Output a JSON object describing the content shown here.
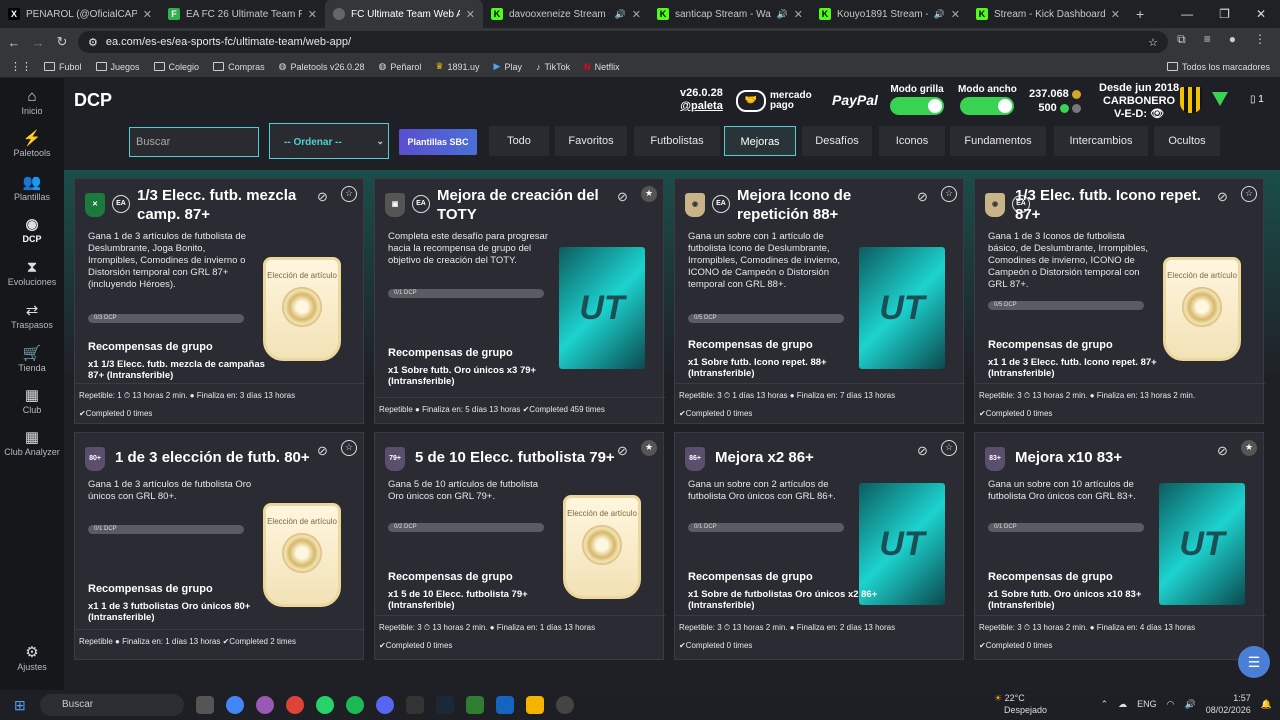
{
  "browser": {
    "tabs": [
      {
        "label": "PEÑAROL (@OficialCAP) / X",
        "favicon": "X",
        "color": "#000000"
      },
      {
        "label": "EA FC 26 Ultimate Team Prices,",
        "favicon": "F",
        "color": "#2db34a"
      },
      {
        "label": "FC Ultimate Team Web App - E",
        "favicon": "•",
        "color": "#555555"
      },
      {
        "label": "davooxeneize Stream - Wat",
        "favicon": "K",
        "color": "#53fc18"
      },
      {
        "label": "santicap Stream - Watch Li",
        "favicon": "K",
        "color": "#53fc18"
      },
      {
        "label": "Kouyo1891 Stream - Watch",
        "favicon": "K",
        "color": "#53fc18"
      },
      {
        "label": "Stream - Kick Dashboard",
        "favicon": "K",
        "color": "#53fc18"
      }
    ],
    "new_tab": "+",
    "url": "ea.com/es-es/ea-sports-fc/ultimate-team/web-app/",
    "bookmarks": [
      "Fubol",
      "Juegos",
      "Colegio",
      "Compras",
      "Paletools v26.0.28",
      "Peñarol",
      "1891.uy",
      "Play",
      "TikTok",
      "Netflix"
    ],
    "all_bookmarks": "Todos los marcadores"
  },
  "sidebar": [
    {
      "label": "Inicio",
      "icon": "home-icon",
      "glyph": "⌂"
    },
    {
      "label": "Paletools",
      "icon": "paletools-icon",
      "glyph": "⚡"
    },
    {
      "label": "Plantillas",
      "icon": "squad-icon",
      "glyph": "👥"
    },
    {
      "label": "DCP",
      "icon": "dcp-icon",
      "glyph": "◉"
    },
    {
      "label": "Evoluciones",
      "icon": "evolutions-icon",
      "glyph": "⧗"
    },
    {
      "label": "Traspasos",
      "icon": "transfers-icon",
      "glyph": "⇄"
    },
    {
      "label": "Tienda",
      "icon": "store-icon",
      "glyph": "🛒"
    },
    {
      "label": "Club",
      "icon": "club-icon",
      "glyph": "▦"
    },
    {
      "label": "Club Analyzer",
      "icon": "club-analyzer-icon",
      "glyph": "▦"
    },
    {
      "label": "Ajustes",
      "icon": "settings-icon",
      "glyph": "⚙"
    }
  ],
  "header": {
    "title": "DCP",
    "version": "v26.0.28",
    "user": "@paleta",
    "mercado_pago": [
      "mercado",
      "pago"
    ],
    "paypal": "PayPal",
    "toggle_grid": "Modo grilla",
    "toggle_wide": "Modo ancho",
    "coins": "237.068",
    "points": "500",
    "club_since": "Desde jun 2018",
    "club_name": "CARBONERO",
    "club_record": "V-E-D:",
    "count": "1"
  },
  "filters": {
    "search_placeholder": "Buscar",
    "sort": "-- Ordenar --",
    "sbc_button": "Plantillas SBC",
    "tabs": [
      "Todo",
      "Favoritos",
      "Futbolistas",
      "Mejoras",
      "Desafíos",
      "Iconos",
      "Fundamentos",
      "Intercambios",
      "Ocultos"
    ],
    "active_tab": "Mejoras"
  },
  "cards": [
    {
      "title": "1/3 Elecc. futb. mezcla camp. 87+",
      "desc": "Gana 1 de 3 artículos de futbolista de Deslumbrante, Joga Bonito, Irrompibles, Comodines de invierno o Distorsión temporal con GRL 87+ (incluyendo Héroes).",
      "progress": "0/3 DCP",
      "rewards_label": "Recompensas de grupo",
      "reward": "x1 1/3 Elecc. futb. mezcla de campañas 87+ (Intransferible)",
      "footer1": "Repetible: 1 ⏱ 13 horas 2 min. ● Finaliza en: 3 días 13 horas",
      "footer2": "✔Completed 0 times",
      "image_label": "Elección de artículo"
    },
    {
      "title": "Mejora de creación del TOTY",
      "desc": "Completa este desafío para progresar hacia la recompensa de grupo del objetivo de creación del TOTY.",
      "progress": "0/1 DCP",
      "rewards_label": "Recompensas de grupo",
      "reward": "x1 Sobre futb. Oro únicos x3 79+ (Intransferible)",
      "footer1": "Repetible ● Finaliza en: 5 días 13 horas ✔Completed 459 times",
      "footer2": ""
    },
    {
      "title": "Mejora Icono de repetición 88+",
      "desc": "Gana un sobre con 1 artículo de futbolista Icono de Deslumbrante, Irrompibles, Comodines de invierno, ICONO de Campeón o Distorsión temporal con GRL 88+.",
      "progress": "0/5 DCP",
      "rewards_label": "Recompensas de grupo",
      "reward": "x1 Sobre futb. Icono repet. 88+ (Intransferible)",
      "footer1": "Repetible: 3 ⏱ 1 días 13 horas ● Finaliza en: 7 días 13 horas",
      "footer2": "✔Completed 0 times"
    },
    {
      "title": "1/3 Elec. futb. Icono repet. 87+",
      "desc": "Gana 1 de 3 Iconos de futbolista básico, de Deslumbrante, Irrompibles, Comodines de invierno, ICONO de Campeón o Distorsión temporal con GRL 87+.",
      "progress": "0/5 DCP",
      "rewards_label": "Recompensas de grupo",
      "reward": "x1 1 de 3 Elecc. futb. Icono repet. 87+ (Intransferible)",
      "footer1": "Repetible: 3 ⏱ 13 horas 2 min. ● Finaliza en: 13 horas 2 min.",
      "footer2": "✔Completed 0 times",
      "image_label": "Elección de artículo"
    },
    {
      "title": "1 de 3 elección de futb. 80+",
      "desc": "Gana 1 de 3 artículos de futbolista Oro únicos con GRL 80+.",
      "progress": "0/1 DCP",
      "rewards_label": "Recompensas de grupo",
      "reward": "x1 1 de 3 futbolistas Oro únicos 80+ (Intransferible)",
      "footer1": "Repetible ● Finaliza en: 1 días 13 horas ✔Completed 2 times",
      "footer2": "",
      "image_label": "Elección de artículo",
      "badge": "80+"
    },
    {
      "title": "5 de 10 Elecc. futbolista 79+",
      "desc": "Gana 5 de 10 artículos de futbolista Oro únicos con GRL 79+.",
      "progress": "0/2 DCP",
      "rewards_label": "Recompensas de grupo",
      "reward": "x1 5 de 10 Elecc. futbolista 79+ (Intransferible)",
      "footer1": "Repetible: 3 ⏱ 13 horas 2 min. ● Finaliza en: 1 días 13 horas",
      "footer2": "✔Completed 0 times",
      "image_label": "Elección de artículo",
      "badge": "79+"
    },
    {
      "title": "Mejora x2 86+",
      "desc": "Gana un sobre con 2 artículos de futbolista Oro únicos con GRL 86+.",
      "progress": "0/1 DCP",
      "rewards_label": "Recompensas de grupo",
      "reward": "x1 Sobre de futbolistas Oro únicos x2 86+ (Intransferible)",
      "footer1": "Repetible: 3 ⏱ 13 horas 2 min. ● Finaliza en: 2 días 13 horas",
      "footer2": "✔Completed 0 times",
      "badge": "86+"
    },
    {
      "title": "Mejora x10 83+",
      "desc": "Gana un sobre con 10 artículos de futbolista Oro únicos con GRL 83+.",
      "progress": "0/1 DCP",
      "rewards_label": "Recompensas de grupo",
      "reward": "x1 Sobre futb. Oro únicos x10 83+ (Intransferible)",
      "footer1": "Repetible: 3 ⏱ 13 horas 2 min. ● Finaliza en: 4 días 13 horas",
      "footer2": "✔Completed 0 times",
      "badge": "83+"
    }
  ],
  "pack_text": "UT",
  "taskbar": {
    "search": "Buscar",
    "temp": "22°C",
    "weather": "Despejado",
    "lang": "ENG",
    "time": "1:57",
    "date": "08/02/2026"
  },
  "colors": {
    "accent": "#4fd0d0",
    "toggle": "#39d353",
    "bg": "#1f2026"
  }
}
